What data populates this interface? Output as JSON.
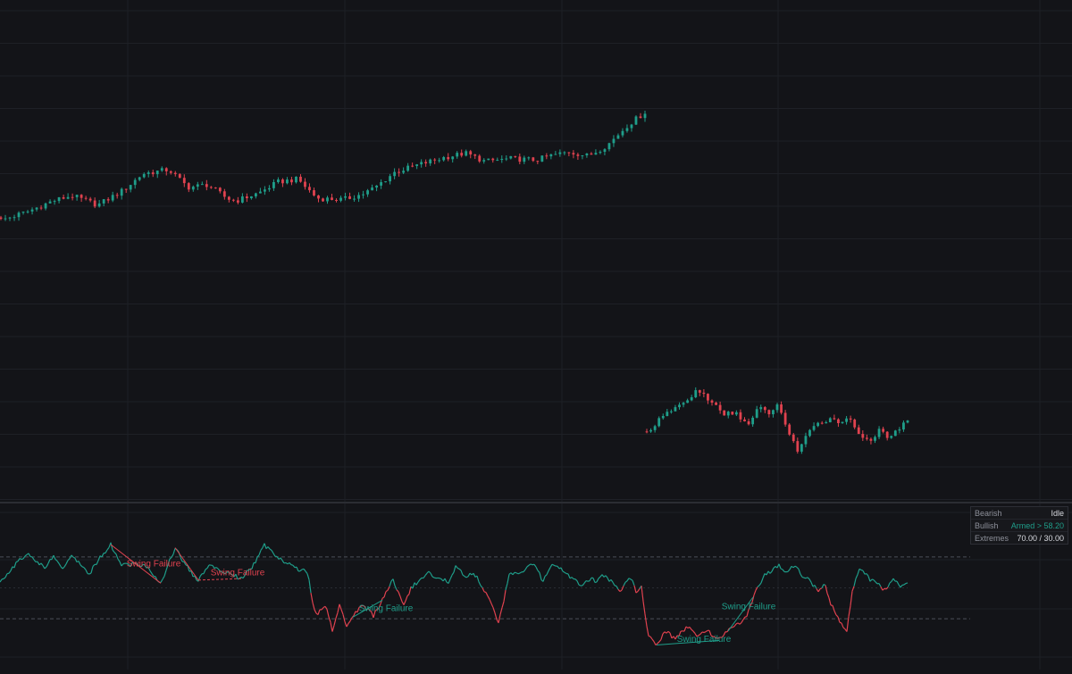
{
  "colors": {
    "background": "#131418",
    "grid": "#1e2026",
    "bullish": "#1f9e8a",
    "bearish": "#e0424f",
    "dashed_level": "#4c4f58",
    "pane_divider": "#2b2d33",
    "status_text": "#d5d7dd"
  },
  "status_table": {
    "rows": [
      {
        "key": "Bearish",
        "value": "Idle",
        "color": "#d5d7dd"
      },
      {
        "key": "Bullish",
        "value": "Armed > 58.20",
        "color": "#1f9e8a"
      },
      {
        "key": "Extremes",
        "value": "70.00 / 30.00",
        "color": "#d5d7dd"
      }
    ]
  },
  "chart_data": [
    {
      "type": "candlestick",
      "pane": "price",
      "note_axes": "no axis labels visible",
      "y_range": [
        0,
        100
      ],
      "segments": [
        {
          "from": 0,
          "to": 144,
          "anchors": [
            [
              0,
              14
            ],
            [
              20,
              20
            ],
            [
              40,
              28
            ],
            [
              55,
              32
            ],
            [
              75,
              25
            ],
            [
              95,
              36
            ],
            [
              110,
              48
            ],
            [
              130,
              51
            ],
            [
              145,
              38
            ],
            [
              160,
              40
            ],
            [
              175,
              30
            ],
            [
              182,
              28
            ],
            [
              200,
              34
            ],
            [
              215,
              42
            ],
            [
              230,
              44
            ],
            [
              245,
              30
            ],
            [
              265,
              29
            ],
            [
              280,
              33
            ],
            [
              290,
              38
            ],
            [
              305,
              49
            ],
            [
              325,
              55
            ],
            [
              344,
              60
            ],
            [
              360,
              63
            ],
            [
              375,
              57
            ],
            [
              395,
              59
            ],
            [
              415,
              58
            ],
            [
              425,
              61
            ],
            [
              440,
              64
            ],
            [
              455,
              61
            ],
            [
              470,
              69
            ],
            [
              485,
              83
            ],
            [
              499,
              93
            ]
          ]
        },
        {
          "from": 145,
          "to": 209,
          "anchors": [
            [
              0,
              12
            ],
            [
              10,
              22
            ],
            [
              20,
              31
            ],
            [
              30,
              36
            ],
            [
              38,
              46
            ],
            [
              48,
              38
            ],
            [
              58,
              26
            ],
            [
              68,
              28
            ],
            [
              78,
              17
            ],
            [
              85,
              32
            ],
            [
              92,
              27
            ],
            [
              100,
              33
            ],
            [
              107,
              16
            ],
            [
              115,
              -3
            ],
            [
              124,
              12
            ],
            [
              132,
              20
            ],
            [
              140,
              23
            ],
            [
              147,
              21
            ],
            [
              155,
              22
            ],
            [
              163,
              10
            ],
            [
              170,
              5
            ],
            [
              177,
              13
            ],
            [
              185,
              7
            ],
            [
              193,
              16
            ],
            [
              199,
              20
            ]
          ]
        }
      ],
      "max_price": 100
    },
    {
      "type": "area",
      "pane": "oscillator",
      "y_range": [
        0,
        100
      ],
      "levels": [
        70,
        30
      ],
      "midline": 50,
      "anchors": [
        [
          0,
          54
        ],
        [
          12,
          62
        ],
        [
          20,
          67
        ],
        [
          30,
          72
        ],
        [
          40,
          68
        ],
        [
          50,
          63
        ],
        [
          60,
          70
        ],
        [
          70,
          63
        ],
        [
          80,
          70
        ],
        [
          90,
          66
        ],
        [
          100,
          59
        ],
        [
          110,
          68
        ],
        [
          124,
          78
        ],
        [
          135,
          65
        ],
        [
          150,
          65
        ],
        [
          165,
          64
        ],
        [
          180,
          53
        ],
        [
          196,
          76
        ],
        [
          205,
          67
        ],
        [
          215,
          59
        ],
        [
          222,
          55
        ],
        [
          236,
          65
        ],
        [
          247,
          61
        ],
        [
          262,
          58
        ],
        [
          270,
          56
        ],
        [
          283,
          64
        ],
        [
          296,
          78
        ],
        [
          304,
          73
        ],
        [
          318,
          67
        ],
        [
          330,
          63
        ],
        [
          345,
          60
        ],
        [
          350,
          40
        ],
        [
          355,
          33
        ],
        [
          365,
          38
        ],
        [
          372,
          22
        ],
        [
          380,
          39
        ],
        [
          388,
          25
        ],
        [
          395,
          31
        ],
        [
          405,
          39
        ],
        [
          418,
          32
        ],
        [
          428,
          42
        ],
        [
          440,
          55
        ],
        [
          452,
          38
        ],
        [
          460,
          50
        ],
        [
          468,
          54
        ],
        [
          478,
          60
        ],
        [
          490,
          56
        ],
        [
          502,
          54
        ],
        [
          510,
          64
        ],
        [
          520,
          58
        ],
        [
          533,
          58
        ],
        [
          542,
          49
        ],
        [
          558,
          28
        ],
        [
          565,
          45
        ],
        [
          570,
          58
        ],
        [
          585,
          60
        ],
        [
          598,
          66
        ],
        [
          608,
          54
        ],
        [
          620,
          66
        ],
        [
          630,
          61
        ],
        [
          640,
          56
        ],
        [
          652,
          51
        ],
        [
          661,
          56
        ],
        [
          668,
          54
        ],
        [
          673,
          59
        ],
        [
          685,
          54
        ],
        [
          695,
          48
        ],
        [
          705,
          58
        ],
        [
          713,
          46
        ],
        [
          718,
          51
        ],
        [
          725,
          20
        ],
        [
          735,
          13
        ],
        [
          745,
          22
        ],
        [
          755,
          17
        ],
        [
          770,
          25
        ],
        [
          780,
          18
        ],
        [
          792,
          22
        ],
        [
          805,
          16
        ],
        [
          815,
          22
        ],
        [
          825,
          27
        ],
        [
          835,
          30
        ],
        [
          843,
          44
        ],
        [
          855,
          58
        ],
        [
          862,
          60
        ],
        [
          872,
          65
        ],
        [
          879,
          60
        ],
        [
          890,
          65
        ],
        [
          898,
          58
        ],
        [
          905,
          56
        ],
        [
          915,
          48
        ],
        [
          923,
          53
        ],
        [
          930,
          40
        ],
        [
          940,
          28
        ],
        [
          948,
          22
        ],
        [
          955,
          51
        ],
        [
          963,
          63
        ],
        [
          971,
          57
        ],
        [
          980,
          53
        ],
        [
          990,
          49
        ],
        [
          1000,
          56
        ],
        [
          1008,
          51
        ],
        [
          1016,
          52
        ]
      ]
    }
  ],
  "labels": {
    "swing_failure": "Swing Failure"
  },
  "annotations": [
    {
      "text": "Swing Failure",
      "x": 172,
      "y": 64,
      "color": "#e0424f"
    },
    {
      "text": "Swing Failure",
      "x": 266,
      "y": 58,
      "color": "#e0424f"
    },
    {
      "text": "Swing Failure",
      "x": 432,
      "y": 35,
      "color": "#1f9e8a"
    },
    {
      "text": "Swing Failure",
      "x": 788,
      "y": 15,
      "color": "#1f9e8a"
    },
    {
      "text": "Swing Failure",
      "x": 838,
      "y": 36,
      "color": "#1f9e8a"
    }
  ]
}
